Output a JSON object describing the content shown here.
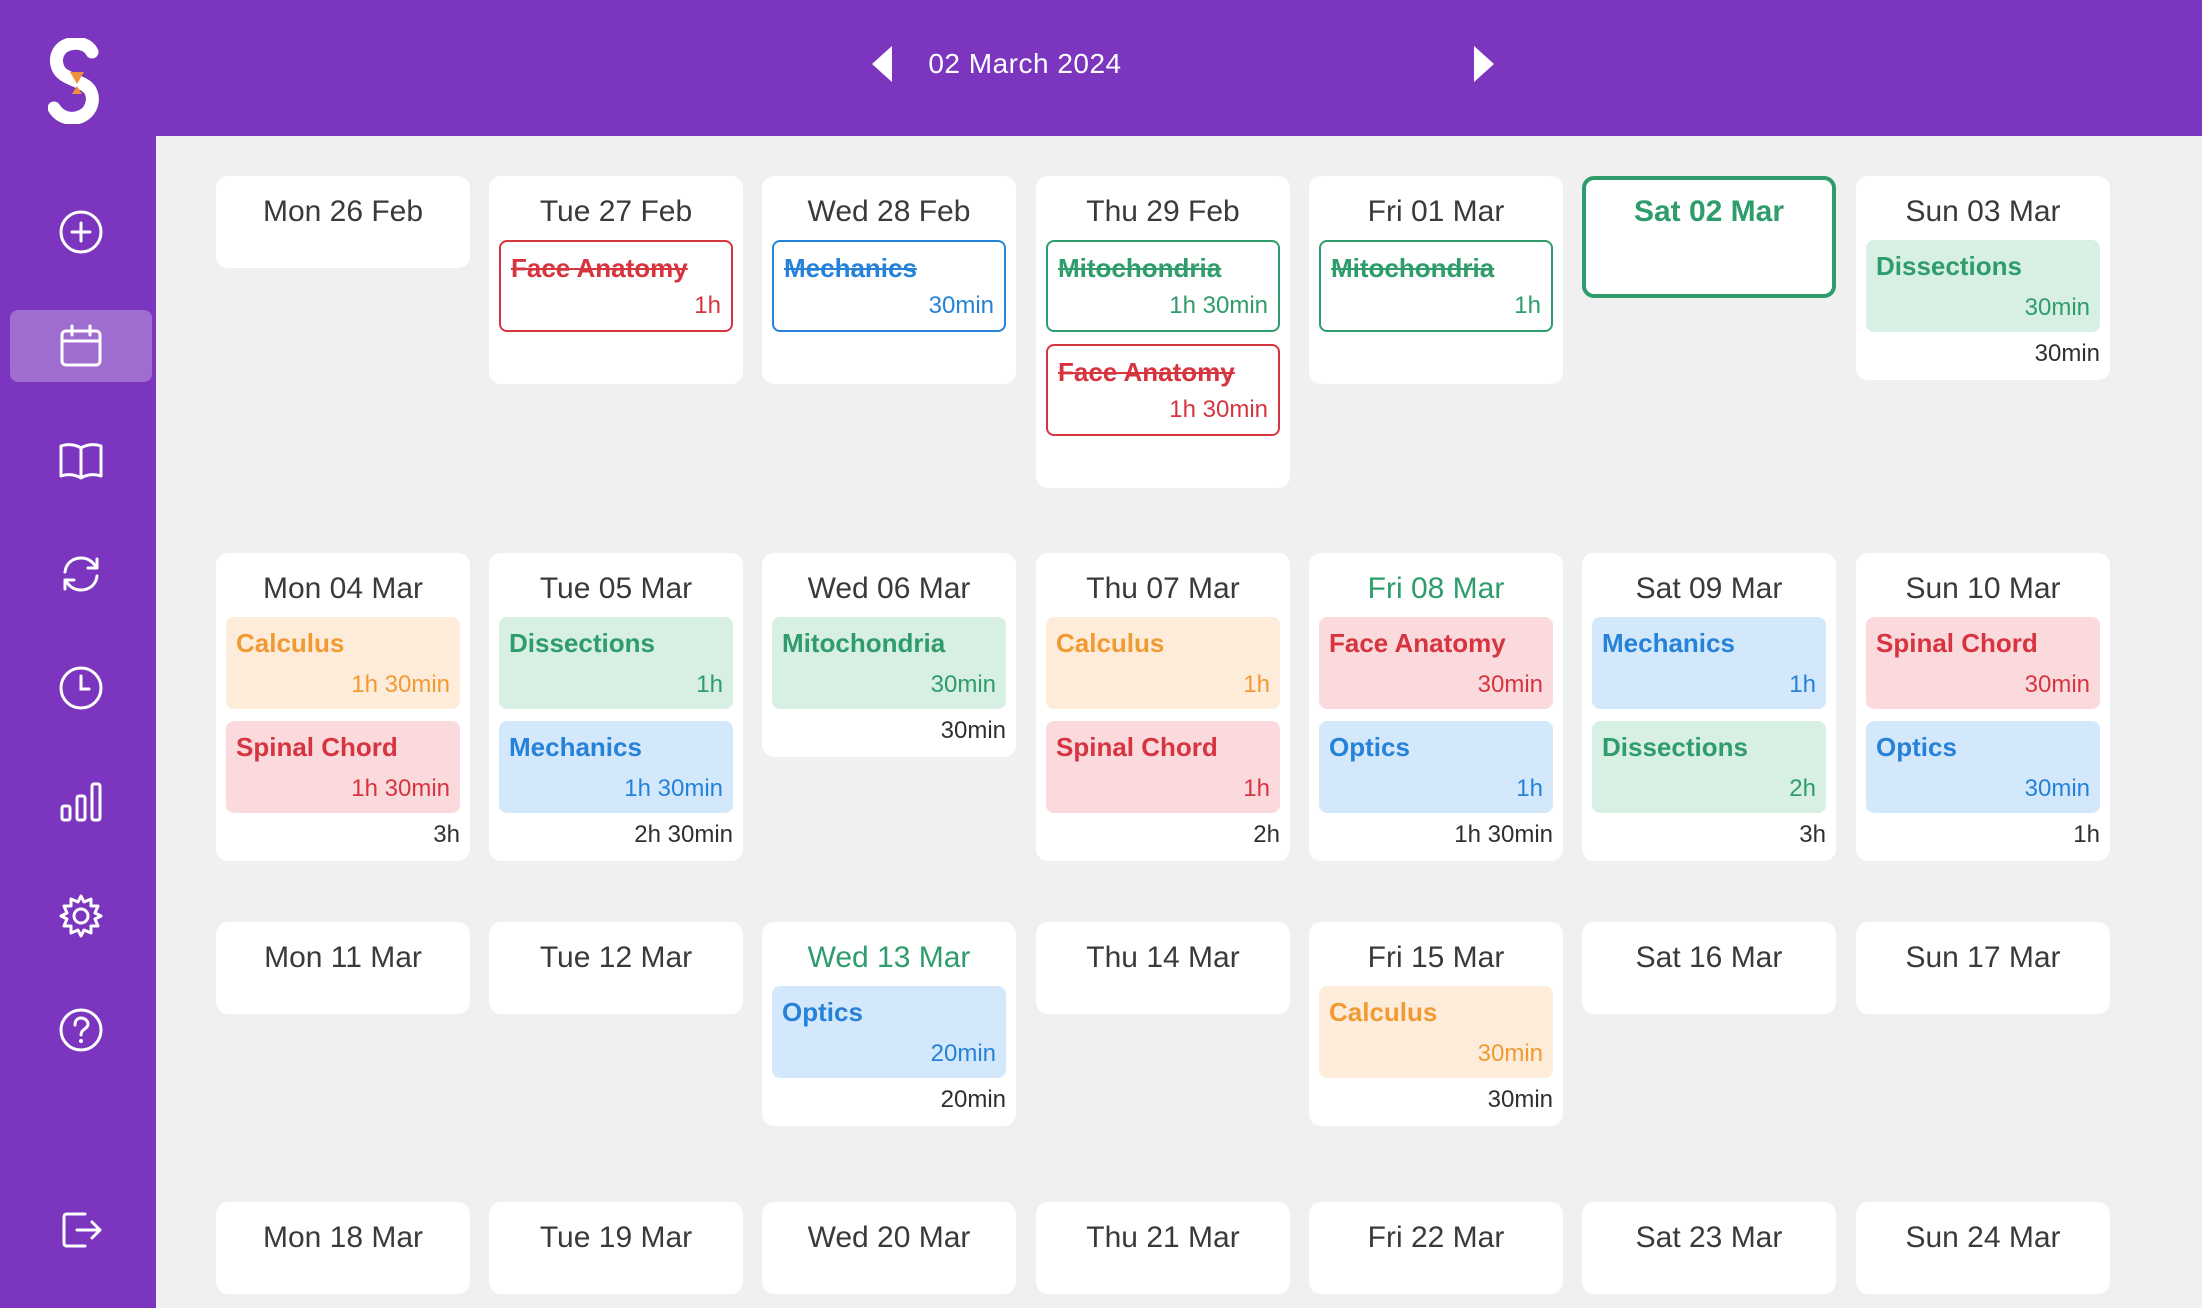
{
  "header": {
    "date": "02 March 2024"
  },
  "colors": {
    "brand": "#7b35be",
    "red": "#d6343f",
    "blue": "#2582d8",
    "green": "#2e9c6b",
    "orange": "#f19a33"
  },
  "sidebar": {
    "items": [
      {
        "name": "add",
        "icon": "plus-circle-icon"
      },
      {
        "name": "calendar",
        "icon": "calendar-icon",
        "active": true
      },
      {
        "name": "subjects",
        "icon": "book-icon"
      },
      {
        "name": "revisions",
        "icon": "refresh-icon"
      },
      {
        "name": "history",
        "icon": "clock-icon"
      },
      {
        "name": "stats",
        "icon": "bar-chart-icon"
      },
      {
        "name": "settings",
        "icon": "gear-icon"
      },
      {
        "name": "help",
        "icon": "help-icon"
      },
      {
        "name": "logout",
        "icon": "logout-icon"
      }
    ]
  },
  "weeks": [
    {
      "days": [
        {
          "label": "Mon 26 Feb",
          "events": [],
          "total": ""
        },
        {
          "label": "Tue 27 Feb",
          "events": [
            {
              "name": "Face Anatomy",
              "dur": "1h",
              "color": "red",
              "done": true
            }
          ],
          "total": ""
        },
        {
          "label": "Wed 28 Feb",
          "events": [
            {
              "name": "Mechanics",
              "dur": "30min",
              "color": "blue",
              "done": true
            }
          ],
          "total": ""
        },
        {
          "label": "Thu 29 Feb",
          "events": [
            {
              "name": "Mitochondria",
              "dur": "1h 30min",
              "color": "green",
              "done": true
            },
            {
              "name": "Face Anatomy",
              "dur": "1h 30min",
              "color": "red",
              "done": true
            }
          ],
          "total": ""
        },
        {
          "label": "Fri 01 Mar",
          "events": [
            {
              "name": "Mitochondria",
              "dur": "1h",
              "color": "green",
              "done": true
            }
          ],
          "total": ""
        },
        {
          "label": "Sat 02 Mar",
          "today": true,
          "events": [],
          "total": ""
        },
        {
          "label": "Sun 03 Mar",
          "events": [
            {
              "name": "Dissections",
              "dur": "30min",
              "color": "green"
            }
          ],
          "total": "30min"
        }
      ]
    },
    {
      "days": [
        {
          "label": "Mon 04 Mar",
          "events": [
            {
              "name": "Calculus",
              "dur": "1h 30min",
              "color": "orange"
            },
            {
              "name": "Spinal Chord",
              "dur": "1h 30min",
              "color": "red"
            }
          ],
          "total": "3h"
        },
        {
          "label": "Tue 05 Mar",
          "events": [
            {
              "name": "Dissections",
              "dur": "1h",
              "color": "green"
            },
            {
              "name": "Mechanics",
              "dur": "1h 30min",
              "color": "blue"
            }
          ],
          "total": "2h 30min"
        },
        {
          "label": "Wed 06 Mar",
          "events": [
            {
              "name": "Mitochondria",
              "dur": "30min",
              "color": "green"
            }
          ],
          "total": "30min"
        },
        {
          "label": "Thu 07 Mar",
          "events": [
            {
              "name": "Calculus",
              "dur": "1h",
              "color": "orange"
            },
            {
              "name": "Spinal Chord",
              "dur": "1h",
              "color": "red"
            }
          ],
          "total": "2h"
        },
        {
          "label": "Fri 08 Mar",
          "highlight": true,
          "events": [
            {
              "name": "Face Anatomy",
              "dur": "30min",
              "color": "red"
            },
            {
              "name": "Optics",
              "dur": "1h",
              "color": "blue"
            }
          ],
          "total": "1h 30min"
        },
        {
          "label": "Sat 09 Mar",
          "events": [
            {
              "name": "Mechanics",
              "dur": "1h",
              "color": "blue"
            },
            {
              "name": "Dissections",
              "dur": "2h",
              "color": "green"
            }
          ],
          "total": "3h"
        },
        {
          "label": "Sun 10 Mar",
          "events": [
            {
              "name": "Spinal Chord",
              "dur": "30min",
              "color": "red"
            },
            {
              "name": "Optics",
              "dur": "30min",
              "color": "blue"
            }
          ],
          "total": "1h"
        }
      ]
    },
    {
      "days": [
        {
          "label": "Mon 11 Mar",
          "events": [],
          "total": ""
        },
        {
          "label": "Tue 12 Mar",
          "events": [],
          "total": ""
        },
        {
          "label": "Wed 13 Mar",
          "highlight": true,
          "events": [
            {
              "name": "Optics",
              "dur": "20min",
              "color": "blue"
            }
          ],
          "total": "20min"
        },
        {
          "label": "Thu 14 Mar",
          "events": [],
          "total": ""
        },
        {
          "label": "Fri 15 Mar",
          "events": [
            {
              "name": "Calculus",
              "dur": "30min",
              "color": "orange"
            }
          ],
          "total": "30min"
        },
        {
          "label": "Sat 16 Mar",
          "events": [],
          "total": ""
        },
        {
          "label": "Sun 17 Mar",
          "events": [],
          "total": ""
        }
      ]
    },
    {
      "days": [
        {
          "label": "Mon 18 Mar",
          "events": [],
          "total": ""
        },
        {
          "label": "Tue 19 Mar",
          "events": [],
          "total": ""
        },
        {
          "label": "Wed 20 Mar",
          "events": [],
          "total": ""
        },
        {
          "label": "Thu 21 Mar",
          "events": [],
          "total": ""
        },
        {
          "label": "Fri 22 Mar",
          "events": [],
          "total": ""
        },
        {
          "label": "Sat 23 Mar",
          "events": [],
          "total": ""
        },
        {
          "label": "Sun 24 Mar",
          "events": [],
          "total": ""
        }
      ]
    }
  ]
}
